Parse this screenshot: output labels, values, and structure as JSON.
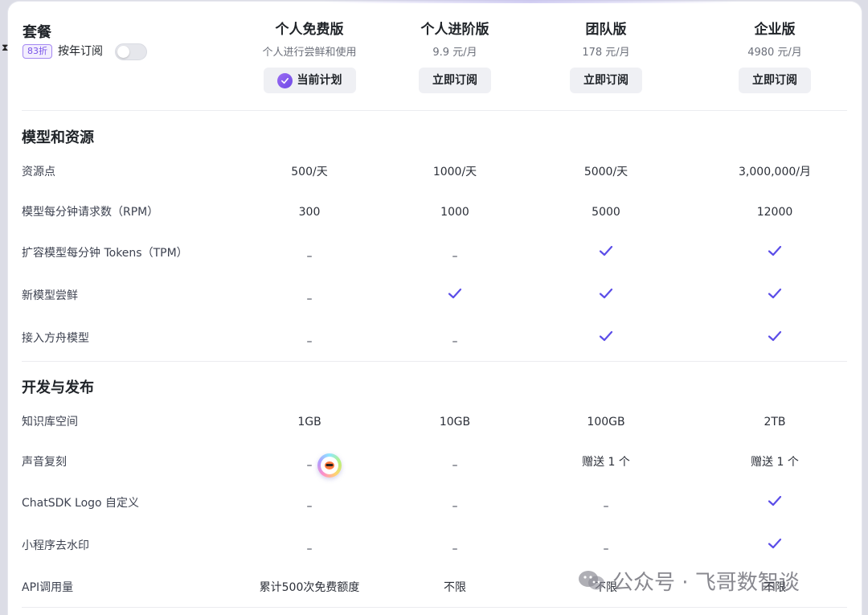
{
  "header": {
    "title": "套餐",
    "discount_badge": "83折",
    "yearly_label": "按年订阅",
    "yearly_enabled": false
  },
  "tiers": [
    {
      "name": "个人免费版",
      "price": "个人进行尝鲜和使用",
      "button": "当前计划",
      "current": true
    },
    {
      "name": "个人进阶版",
      "price": "9.9 元/月",
      "button": "立即订阅",
      "current": false
    },
    {
      "name": "团队版",
      "price": "178 元/月",
      "button": "立即订阅",
      "current": false
    },
    {
      "name": "企业版",
      "price": "4980 元/月",
      "button": "立即订阅",
      "current": false
    }
  ],
  "sections": [
    {
      "title": "模型和资源",
      "rows": [
        {
          "label": "资源点",
          "values": [
            "500/天",
            "1000/天",
            "5000/天",
            "3,000,000/月"
          ]
        },
        {
          "label": "模型每分钟请求数（RPM）",
          "values": [
            "300",
            "1000",
            "5000",
            "12000"
          ]
        },
        {
          "label": "扩容模型每分钟 Tokens（TPM）",
          "values": [
            "–",
            "–",
            "check",
            "check"
          ]
        },
        {
          "label": "新模型尝鲜",
          "values": [
            "–",
            "check",
            "check",
            "check"
          ]
        },
        {
          "label": "接入方舟模型",
          "values": [
            "–",
            "–",
            "check",
            "check"
          ]
        }
      ]
    },
    {
      "title": "开发与发布",
      "rows": [
        {
          "label": "知识库空间",
          "values": [
            "1GB",
            "10GB",
            "100GB",
            "2TB"
          ]
        },
        {
          "label": "声音复刻",
          "values": [
            "–",
            "–",
            "赠送 1 个",
            "赠送 1 个"
          ]
        },
        {
          "label": "ChatSDK Logo 自定义",
          "values": [
            "–",
            "–",
            "–",
            "check"
          ]
        },
        {
          "label": "小程序去水印",
          "values": [
            "–",
            "–",
            "–",
            "check"
          ]
        },
        {
          "label": "API调用量",
          "values": [
            "累计500次免费额度",
            "不限",
            "不限",
            "不限"
          ]
        }
      ]
    }
  ],
  "watermark": "公众号 · 飞哥数智谈",
  "colors": {
    "accent": "#6e4ae6",
    "check": "#5b4de8",
    "button_bg": "#eff0f4"
  }
}
